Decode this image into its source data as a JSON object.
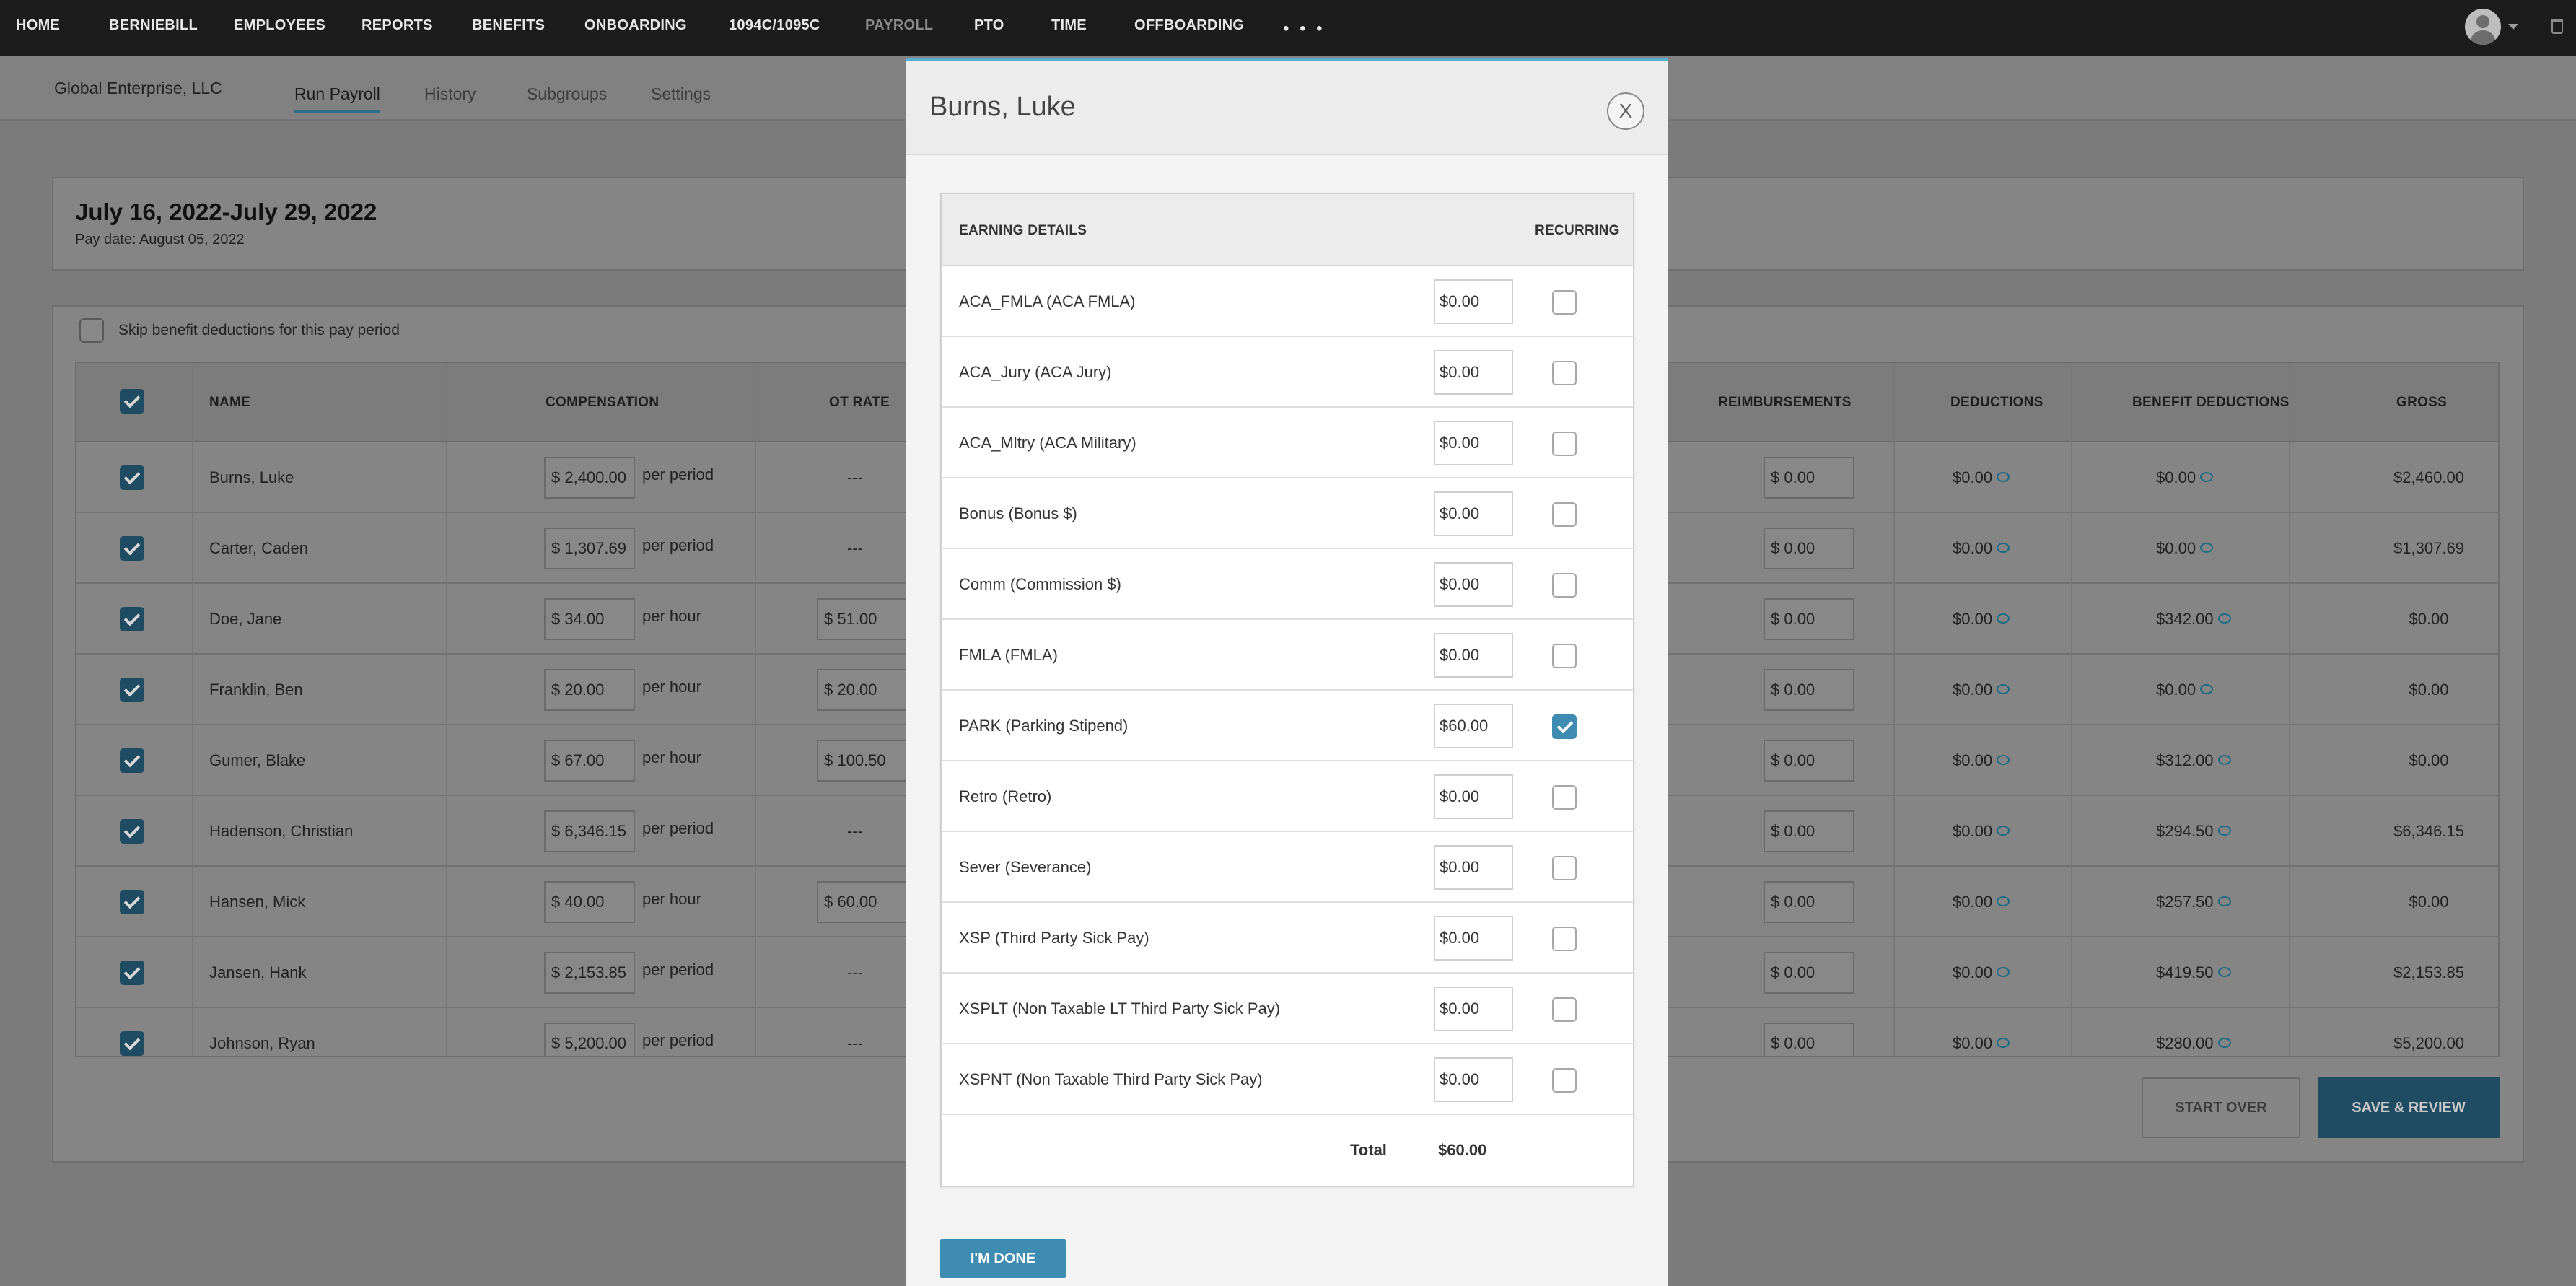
{
  "nav": {
    "items": [
      "HOME",
      "BERNIEBILL",
      "EMPLOYEES",
      "REPORTS",
      "BENEFITS",
      "ONBOARDING",
      "1094C/1095C",
      "PAYROLL",
      "PTO",
      "TIME",
      "OFFBOARDING"
    ],
    "more": "• • •"
  },
  "subheader": {
    "company": "Global Enterprise, LLC",
    "tabs": [
      "Run Payroll",
      "History",
      "Subgroups",
      "Settings"
    ]
  },
  "period": {
    "title": "July 16, 2022-July 29, 2022",
    "pay_date": "Pay date: August 05, 2022"
  },
  "skip_label": "Skip benefit deductions for this pay period",
  "table": {
    "headers": {
      "name": "NAME",
      "compensation": "COMPENSATION",
      "ot_rate": "OT RATE",
      "reimbursements": "REIMBURSEMENTS",
      "deductions": "DEDUCTIONS",
      "benefit_deductions": "BENEFIT DEDUCTIONS",
      "gross": "GROSS"
    },
    "rows": [
      {
        "name": "Burns, Luke",
        "comp": "$ 2,400.00",
        "unit": "per period",
        "ot": "---",
        "reimb": "$    0.00",
        "ded": "$0.00",
        "ben": "$0.00",
        "gross": "$2,460.00"
      },
      {
        "name": "Carter, Caden",
        "comp": "$ 1,307.69",
        "unit": "per period",
        "ot": "---",
        "reimb": "$    0.00",
        "ded": "$0.00",
        "ben": "$0.00",
        "gross": "$1,307.69"
      },
      {
        "name": "Doe, Jane",
        "comp": "$       34.00",
        "unit": "per hour",
        "ot": "$    51.00",
        "reimb": "$    0.00",
        "ded": "$0.00",
        "ben": "$342.00",
        "gross": "$0.00"
      },
      {
        "name": "Franklin, Ben",
        "comp": "$       20.00",
        "unit": "per hour",
        "ot": "$    20.00",
        "reimb": "$    0.00",
        "ded": "$0.00",
        "ben": "$0.00",
        "gross": "$0.00"
      },
      {
        "name": "Gumer, Blake",
        "comp": "$       67.00",
        "unit": "per hour",
        "ot": "$  100.50",
        "reimb": "$    0.00",
        "ded": "$0.00",
        "ben": "$312.00",
        "gross": "$0.00"
      },
      {
        "name": "Hadenson, Christian",
        "comp": "$ 6,346.15",
        "unit": "per period",
        "ot": "---",
        "reimb": "$    0.00",
        "ded": "$0.00",
        "ben": "$294.50",
        "gross": "$6,346.15"
      },
      {
        "name": "Hansen, Mick",
        "comp": "$       40.00",
        "unit": "per hour",
        "ot": "$    60.00",
        "reimb": "$    0.00",
        "ded": "$0.00",
        "ben": "$257.50",
        "gross": "$0.00"
      },
      {
        "name": "Jansen, Hank",
        "comp": "$ 2,153.85",
        "unit": "per period",
        "ot": "---",
        "reimb": "$    0.00",
        "ded": "$0.00",
        "ben": "$419.50",
        "gross": "$2,153.85"
      },
      {
        "name": "Johnson, Ryan",
        "comp": "$ 5,200.00",
        "unit": "per period",
        "ot": "---",
        "reimb": "$    0.00",
        "ded": "$0.00",
        "ben": "$280.00",
        "gross": "$5,200.00"
      }
    ]
  },
  "buttons": {
    "start_over": "START OVER",
    "save_review": "SAVE & REVIEW"
  },
  "modal": {
    "title": "Burns, Luke",
    "close": "X",
    "col_earning": "EARNING DETAILS",
    "col_recurring": "RECURRING",
    "earnings": [
      {
        "label": "ACA_FMLA (ACA FMLA)",
        "value": "$0.00",
        "recurring": false
      },
      {
        "label": "ACA_Jury (ACA Jury)",
        "value": "$0.00",
        "recurring": false
      },
      {
        "label": "ACA_Mltry (ACA Military)",
        "value": "$0.00",
        "recurring": false
      },
      {
        "label": "Bonus (Bonus $)",
        "value": "$0.00",
        "recurring": false
      },
      {
        "label": "Comm (Commission $)",
        "value": "$0.00",
        "recurring": false
      },
      {
        "label": "FMLA (FMLA)",
        "value": "$0.00",
        "recurring": false
      },
      {
        "label": "PARK (Parking Stipend)",
        "value": "$60.00",
        "recurring": true
      },
      {
        "label": "Retro (Retro)",
        "value": "$0.00",
        "recurring": false
      },
      {
        "label": "Sever (Severance)",
        "value": "$0.00",
        "recurring": false
      },
      {
        "label": "XSP (Third Party Sick Pay)",
        "value": "$0.00",
        "recurring": false
      },
      {
        "label": "XSPLT (Non Taxable LT Third Party Sick Pay)",
        "value": "$0.00",
        "recurring": false
      },
      {
        "label": "XSPNT (Non Taxable Third Party Sick Pay)",
        "value": "$0.00",
        "recurring": false
      }
    ],
    "total_label": "Total",
    "total_value": "$60.00",
    "done": "I'M DONE"
  }
}
